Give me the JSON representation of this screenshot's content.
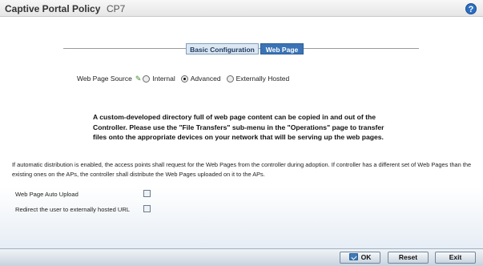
{
  "header": {
    "title": "Captive Portal Policy",
    "policy_name": "CP7",
    "help_icon_text": "?"
  },
  "tabs": [
    {
      "label": "Basic Configuration",
      "active": false
    },
    {
      "label": "Web Page",
      "active": true
    }
  ],
  "web_page_source": {
    "label": "Web Page Source",
    "icon": "pencil-icon",
    "options": [
      {
        "label": "Internal",
        "selected": false
      },
      {
        "label": "Advanced",
        "selected": true
      },
      {
        "label": "Externally Hosted",
        "selected": false
      }
    ]
  },
  "notice": "A custom-developed directory full of web page content can be copied in and out of the Controller. Please use the \"File Transfers\" sub-menu in the \"Operations\" page to transfer files onto the appropriate devices on your network that will be serving up the web pages.",
  "distribution_note": "If automatic distribution is enabled, the access points shall request for the Web Pages from the controller during adoption. If controller has a different set of Web Pages than the existing ones on the APs, the controller shall distribute the Web Pages uploaded on it to the APs.",
  "fields": {
    "auto_upload_label": "Web Page Auto Upload",
    "auto_upload_checked": false,
    "redirect_label": "Redirect the user to externally hosted URL",
    "redirect_checked": false
  },
  "buttons": {
    "ok": "OK",
    "reset": "Reset",
    "exit": "Exit"
  },
  "colors": {
    "accent": "#3b74b6",
    "help": "#2a6fc1"
  }
}
